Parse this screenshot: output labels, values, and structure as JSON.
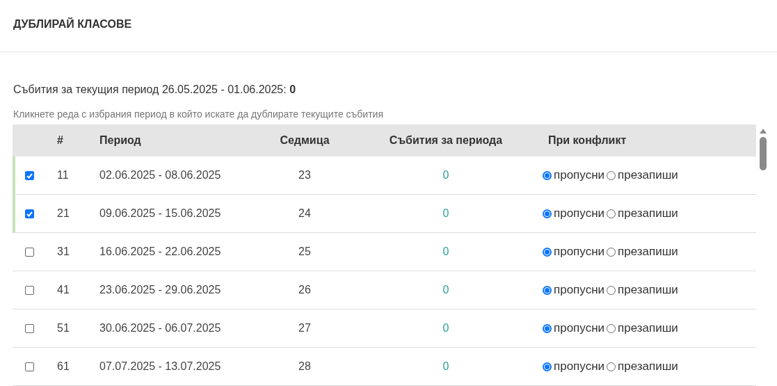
{
  "title": "ДУБЛИРАЙ КЛАСОВЕ",
  "summary": {
    "text": "Събития за текущия период 26.05.2025 - 01.06.2025:",
    "count": "0"
  },
  "hint": "Кликнете реда с избрания период в който искате да дублирате текущите събития",
  "table": {
    "columns": [
      "#",
      "Период",
      "Седмица",
      "Събития за периода",
      "При конфликт"
    ],
    "rows": [
      {
        "checked": true,
        "number": "11",
        "period": "02.06.2025 - 08.06.2025",
        "week": "23",
        "events": "0",
        "options": [
          {
            "label": "пропусни",
            "selected": true
          },
          {
            "label": "презапиши",
            "selected": false
          }
        ]
      },
      {
        "checked": true,
        "number": "21",
        "period": "09.06.2025 - 15.06.2025",
        "week": "24",
        "events": "0",
        "options": [
          {
            "label": "пропусни",
            "selected": true
          },
          {
            "label": "презапиши",
            "selected": false
          }
        ]
      },
      {
        "checked": false,
        "number": "31",
        "period": "16.06.2025 - 22.06.2025",
        "week": "25",
        "events": "0",
        "options": [
          {
            "label": "пропусни",
            "selected": true
          },
          {
            "label": "презапиши",
            "selected": false
          }
        ]
      },
      {
        "checked": false,
        "number": "41",
        "period": "23.06.2025 - 29.06.2025",
        "week": "26",
        "events": "0",
        "options": [
          {
            "label": "пропусни",
            "selected": true
          },
          {
            "label": "презапиши",
            "selected": false
          }
        ]
      },
      {
        "checked": false,
        "number": "51",
        "period": "30.06.2025 - 06.07.2025",
        "week": "27",
        "events": "0",
        "options": [
          {
            "label": "пропусни",
            "selected": true
          },
          {
            "label": "презапиши",
            "selected": false
          }
        ]
      },
      {
        "checked": false,
        "number": "61",
        "period": "07.07.2025 - 13.07.2025",
        "week": "28",
        "events": "0",
        "options": [
          {
            "label": "пропусни",
            "selected": true
          },
          {
            "label": "презапиши",
            "selected": false
          }
        ]
      }
    ]
  }
}
